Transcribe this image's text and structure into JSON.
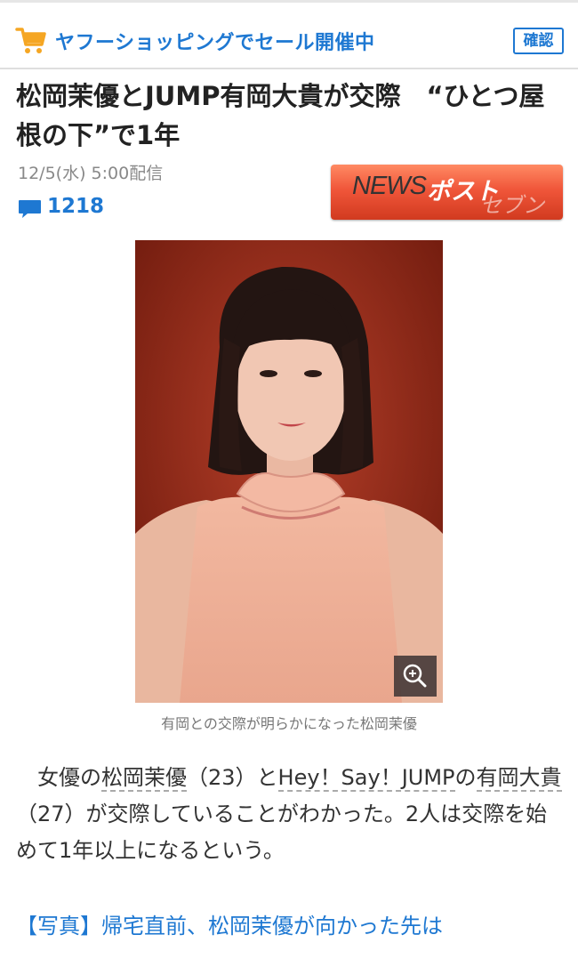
{
  "promo": {
    "text": "ヤフーショッピングでセール開催中",
    "confirm_label": "確認"
  },
  "article": {
    "title": "松岡茉優とJUMP有岡大貴が交際　“ひとつ屋根の下”で1年",
    "date": "12/5(水) 5:00配信",
    "comment_count": "1218",
    "source_logo": {
      "part1": "NEWS",
      "part2": "ポスト",
      "part3": "セブン"
    },
    "photo_caption": "有岡との交際が明らかになった松岡茉優",
    "body": {
      "s1": "女優の",
      "kw1": "松岡茉優",
      "s2": "（23）と",
      "kw2": "Hey！Say！JUMP",
      "s3": "の",
      "kw3": "有岡大貴",
      "s4": "（27）が交際していることがわかった。2人は交際を始めて1年以上になるという。"
    },
    "related": {
      "tag": "【写真】",
      "text": "帰宅直前、松岡茉優が向かった先は"
    }
  },
  "colors": {
    "accent_blue": "#1e78d2",
    "logo_red": "#f0563a",
    "cart_orange": "#f5a623"
  },
  "icons": [
    "cart-icon",
    "comment-bubble-icon",
    "zoom-icon"
  ]
}
